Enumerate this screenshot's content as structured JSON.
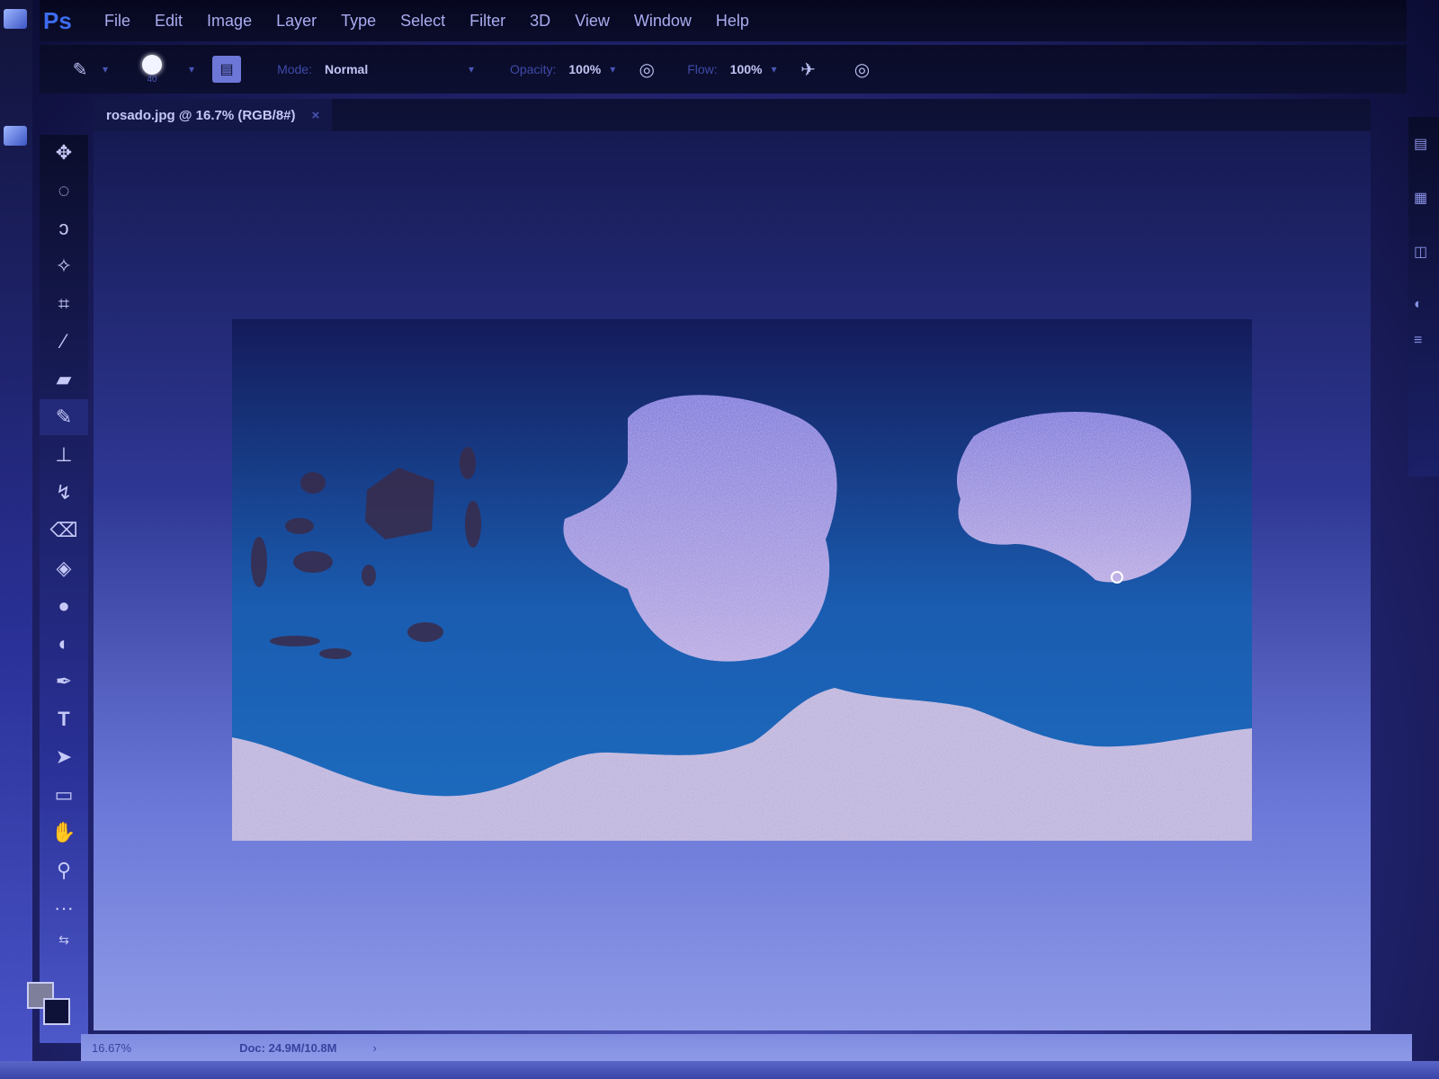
{
  "app": {
    "logo": "Ps"
  },
  "menubar": {
    "items": [
      "File",
      "Edit",
      "Image",
      "Layer",
      "Type",
      "Select",
      "Filter",
      "3D",
      "View",
      "Window",
      "Help"
    ]
  },
  "options": {
    "brush_size": "40",
    "mode_label": "Mode:",
    "mode_value": "Normal",
    "opacity_label": "Opacity:",
    "opacity_value": "100%",
    "flow_label": "Flow:",
    "flow_value": "100%"
  },
  "document_tab": {
    "title": "rosado.jpg @ 16.7% (RGB/8#)",
    "close": "×"
  },
  "tools": [
    {
      "name": "move-tool",
      "icon": "move-icon",
      "glyph": "✥"
    },
    {
      "name": "marquee-tool",
      "icon": "marquee-icon",
      "glyph": "◌"
    },
    {
      "name": "lasso-tool",
      "icon": "lasso-icon",
      "glyph": "ↄ"
    },
    {
      "name": "magic-wand-tool",
      "icon": "magic-wand-icon",
      "glyph": "✧"
    },
    {
      "name": "crop-tool",
      "icon": "crop-icon",
      "glyph": "⌗"
    },
    {
      "name": "eyedropper-tool",
      "icon": "eyedropper-icon",
      "glyph": "⁄"
    },
    {
      "name": "healing-brush-tool",
      "icon": "bandage-icon",
      "glyph": "▰"
    },
    {
      "name": "brush-tool",
      "icon": "brush-icon",
      "glyph": "✎"
    },
    {
      "name": "clone-stamp-tool",
      "icon": "stamp-icon",
      "glyph": "⊥"
    },
    {
      "name": "history-brush-tool",
      "icon": "history-brush-icon",
      "glyph": "↯"
    },
    {
      "name": "eraser-tool",
      "icon": "eraser-icon",
      "glyph": "⌫"
    },
    {
      "name": "paint-bucket-tool",
      "icon": "paint-bucket-icon",
      "glyph": "◈"
    },
    {
      "name": "blur-tool",
      "icon": "droplet-icon",
      "glyph": "●"
    },
    {
      "name": "dodge-tool",
      "icon": "dodge-icon",
      "glyph": "◐"
    },
    {
      "name": "pen-tool",
      "icon": "pen-icon",
      "glyph": "✒"
    },
    {
      "name": "type-tool",
      "icon": "type-icon",
      "glyph": "T"
    },
    {
      "name": "path-selection-tool",
      "icon": "arrow-icon",
      "glyph": "➤"
    },
    {
      "name": "rectangle-tool",
      "icon": "rectangle-icon",
      "glyph": "▭"
    },
    {
      "name": "hand-tool",
      "icon": "hand-icon",
      "glyph": "✋"
    },
    {
      "name": "zoom-tool",
      "icon": "zoom-icon",
      "glyph": "⚲"
    },
    {
      "name": "more-tools",
      "icon": "ellipsis-icon",
      "glyph": "···"
    }
  ],
  "status": {
    "zoom": "16.67%",
    "doc_label": "Doc: 24.9M/10.8M",
    "arrow": "›"
  },
  "colors": {
    "foreground": "#7d7f9b",
    "background": "#0f1238"
  }
}
